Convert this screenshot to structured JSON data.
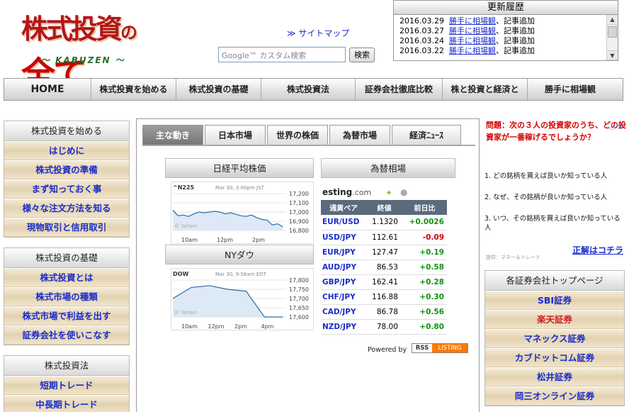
{
  "header": {
    "logo_text_main": "株式投資",
    "logo_text_no": "の",
    "logo_text_zen": "全て",
    "logo_sub": "〜 KABUZEN 〜",
    "sitemap_link": "≫ サイトマップ",
    "search_placeholder": "Google™ カスタム検索",
    "search_button": "検索"
  },
  "history": {
    "title": "更新履歴",
    "items": [
      {
        "date": "2016.03.29",
        "link": "勝手に相場観",
        "suffix": "、記事追加"
      },
      {
        "date": "2016.03.27",
        "link": "勝手に相場観",
        "suffix": "、記事追加"
      },
      {
        "date": "2016.03.24",
        "link": "勝手に相場観",
        "suffix": "、記事追加"
      },
      {
        "date": "2016.03.22",
        "link": "勝手に相場観",
        "suffix": "、記事追加"
      }
    ]
  },
  "nav": [
    "HOME",
    "株式投資を始める",
    "株式投資の基礎",
    "株式投資法",
    "証券会社徹底比較",
    "株と投資と経済と",
    "勝手に相場観"
  ],
  "left_sections": [
    {
      "title": "株式投資を始める",
      "items": [
        "はじめに",
        "株式投資の準備",
        "まず知っておく事",
        "様々な注文方法を知る",
        "現物取引と信用取引"
      ]
    },
    {
      "title": "株式投資の基礎",
      "items": [
        "株式投資とは",
        "株式市場の種類",
        "株式市場で利益を出す",
        "証券会社を使いこなす"
      ]
    },
    {
      "title": "株式投資法",
      "items": [
        "短期トレード",
        "中長期トレード"
      ]
    }
  ],
  "tabs": [
    "主な動き",
    "日本市場",
    "世界の株価",
    "為替市場",
    "経済ﾆｭｰｽ"
  ],
  "panels": {
    "nikkei_title": "日経平均株価",
    "nikkei_chart": {
      "symbol": "^N225",
      "stamp": "Mar 30, 3:00pm JST",
      "credit": "© Yahoo!",
      "yticks": [
        "17,200",
        "17,100",
        "17,000",
        "16,900",
        "16,800"
      ],
      "xticks": [
        "10am",
        "12pm",
        "2pm"
      ]
    },
    "dow_title": "NYダウ",
    "dow_chart": {
      "symbol": "DOW",
      "stamp": "Mar 30, 9:56am EDT",
      "credit": "© Yahoo!",
      "yticks": [
        "17,800",
        "17,750",
        "17,700",
        "17,650",
        "17,600"
      ],
      "xticks": [
        "10am",
        "12pm",
        "2pm",
        "4pm"
      ]
    },
    "fx_title": "為替相場"
  },
  "fx": {
    "logo": "esting",
    "logo_suffix": ".com",
    "headers": [
      "通貨ペア",
      "終値",
      "前日比"
    ],
    "rows": [
      {
        "pair": "EUR/USD",
        "rate": "1.1320",
        "chg": "+0.0026",
        "dir": "pos"
      },
      {
        "pair": "USD/JPY",
        "rate": "112.61",
        "chg": "-0.09",
        "dir": "neg"
      },
      {
        "pair": "EUR/JPY",
        "rate": "127.47",
        "chg": "+0.19",
        "dir": "pos"
      },
      {
        "pair": "AUD/JPY",
        "rate": "86.53",
        "chg": "+0.58",
        "dir": "pos"
      },
      {
        "pair": "GBP/JPY",
        "rate": "162.41",
        "chg": "+0.28",
        "dir": "pos"
      },
      {
        "pair": "CHF/JPY",
        "rate": "116.88",
        "chg": "+0.30",
        "dir": "pos"
      },
      {
        "pair": "CAD/JPY",
        "rate": "86.78",
        "chg": "+0.56",
        "dir": "pos"
      },
      {
        "pair": "NZD/JPY",
        "rate": "78.00",
        "chg": "+0.80",
        "dir": "pos"
      }
    ],
    "powered": "Powered by",
    "rss_a": "RSS",
    "rss_b": "LISTING"
  },
  "ad": {
    "question": "問題：次の３人の投資家のうち、どの投資家が一番稼げるでしょうか？",
    "options": [
      "1. どの銘柄を買えば良いか知っている人",
      "2. なぜ、その銘柄が良いか知っている人",
      "3. いつ、その銘柄を買えば良いか知っている人"
    ],
    "answer_link": "正解はコチラ",
    "credit": "提供：マネー＆トレード"
  },
  "right_box": {
    "title": "各証券会社トップページ",
    "items": [
      "SBI証券",
      "楽天証券",
      "マネックス証券",
      "カブドットコム証券",
      "松井証券",
      "岡三オンライン証券"
    ]
  }
}
